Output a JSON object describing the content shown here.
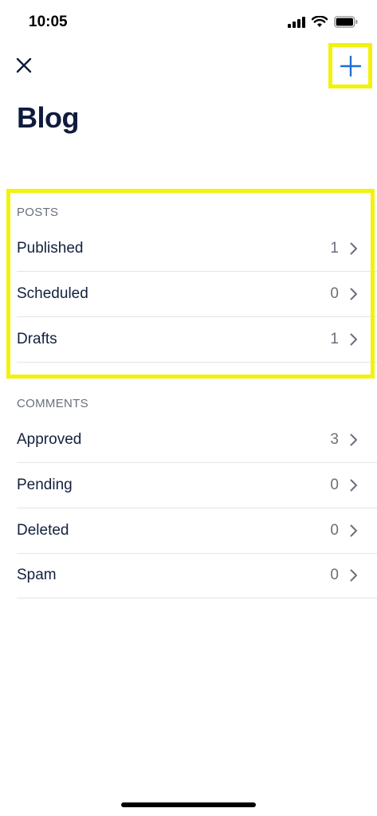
{
  "status_bar": {
    "time": "10:05"
  },
  "nav": {
    "close_icon": "close-icon",
    "add_icon": "plus-icon",
    "accent_color": "#1f6fd6"
  },
  "title": "Blog",
  "sections": [
    {
      "header": "POSTS",
      "rows": [
        {
          "label": "Published",
          "count": "1"
        },
        {
          "label": "Scheduled",
          "count": "0"
        },
        {
          "label": "Drafts",
          "count": "1"
        }
      ]
    },
    {
      "header": "COMMENTS",
      "rows": [
        {
          "label": "Approved",
          "count": "3"
        },
        {
          "label": "Pending",
          "count": "0"
        },
        {
          "label": "Deleted",
          "count": "0"
        },
        {
          "label": "Spam",
          "count": "0"
        }
      ]
    }
  ],
  "highlight_color": "#f2f20a"
}
